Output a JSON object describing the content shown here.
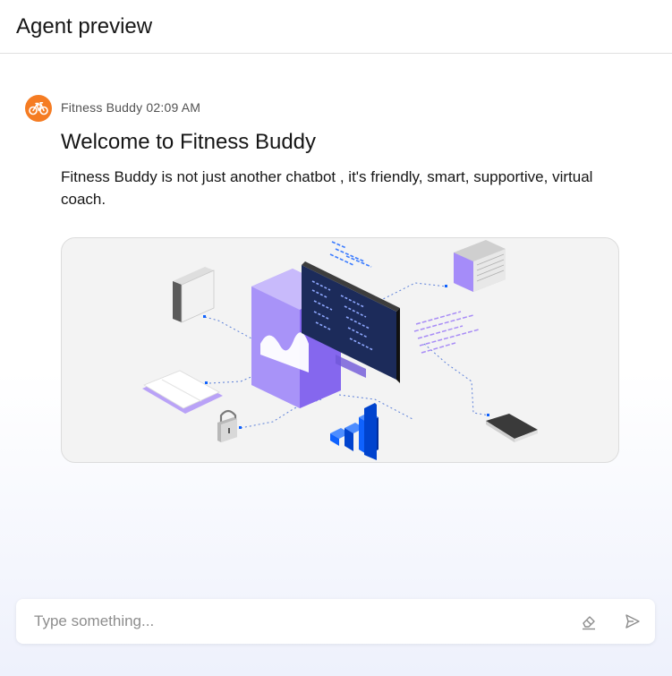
{
  "header": {
    "title": "Agent preview"
  },
  "message": {
    "sender": "Fitness Buddy",
    "time": "02:09 AM",
    "avatar_icon": "bicycle-icon",
    "title": "Welcome to Fitness Buddy",
    "body": "Fitness Buddy is not just another chatbot , it's friendly, smart, supportive, virtual coach."
  },
  "composer": {
    "placeholder": "Type something...",
    "clear_icon": "eraser-icon",
    "send_icon": "send-icon"
  },
  "colors": {
    "accent_orange": "#f57c23",
    "purple": "#8a6cf5",
    "blue": "#0f62fe",
    "navy": "#1c2b5a"
  }
}
